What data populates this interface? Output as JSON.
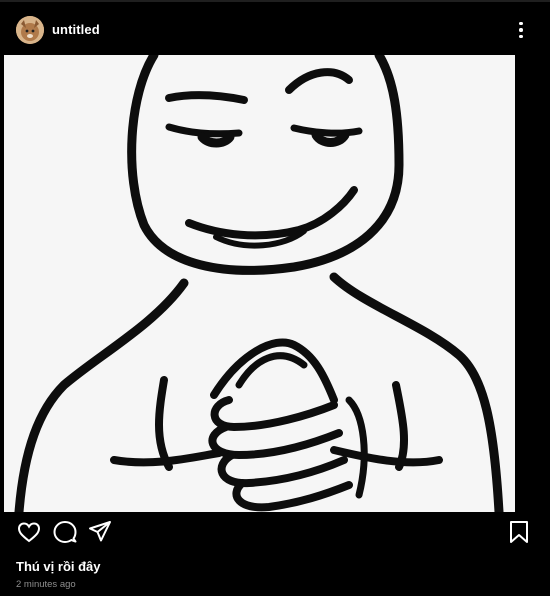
{
  "post": {
    "username": "untitled",
    "caption": "Thú vị rồi đây",
    "timestamp": "2 minutes ago"
  },
  "icons": {
    "avatar": "profile-avatar",
    "more": "more-vertical-icon",
    "like": "heart-outline-icon",
    "comment": "comment-bubble-icon",
    "share": "paper-plane-icon",
    "save": "bookmark-outline-icon"
  },
  "colors": {
    "background": "#000000",
    "text": "#ffffff",
    "secondary_text": "#8e8e8e"
  }
}
